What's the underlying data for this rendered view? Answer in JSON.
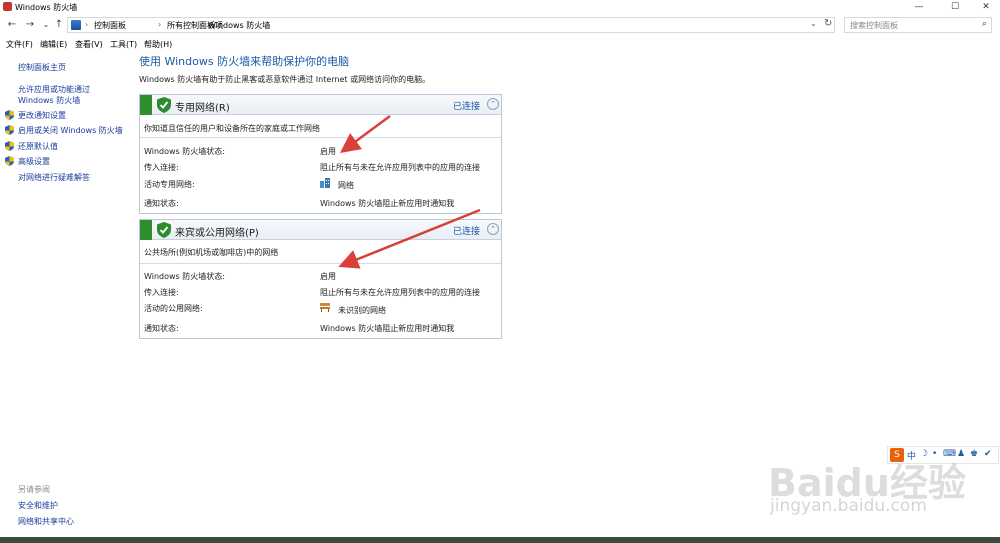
{
  "window": {
    "title": "Windows 防火墙",
    "min": "—",
    "max": "☐",
    "close": "✕"
  },
  "nav": {
    "back": "←",
    "forward": "→",
    "dropdown": "⌄",
    "up": "↑"
  },
  "breadcrumb": {
    "items": [
      "控制面板",
      "所有控制面板项",
      "Windows 防火墙"
    ],
    "sep": "›",
    "dd": "⌄",
    "refresh": "↻"
  },
  "search": {
    "placeholder": "搜索控制面板",
    "icon": "⌕"
  },
  "menu": [
    "文件(F)",
    "编辑(E)",
    "查看(V)",
    "工具(T)",
    "帮助(H)"
  ],
  "sidebar": {
    "home": "控制面板主页",
    "allow_app": "允许应用或功能通过 Windows 防火墙",
    "items": [
      "更改通知设置",
      "启用或关闭 Windows 防火墙",
      "还原默认值",
      "高级设置"
    ],
    "troubleshoot": "对网络进行疑难解答",
    "see_also_title": "另请参阅",
    "see_also": [
      "安全和维护",
      "网络和共享中心"
    ]
  },
  "main": {
    "title": "使用 Windows 防火墙来帮助保护你的电脑",
    "description": "Windows 防火墙有助于防止黑客或恶意软件通过 Internet 或网络访问你的电脑。"
  },
  "panels": [
    {
      "name": "专用网络(R)",
      "status": "已连接",
      "chevron": "⌃",
      "description": "你知道且信任的用户和设备所在的家庭或工作网络",
      "rows": [
        {
          "label": "Windows 防火墙状态:",
          "value": "启用"
        },
        {
          "label": "传入连接:",
          "value": "阻止所有与未在允许应用列表中的应用的连接"
        },
        {
          "label": "活动专用网络:",
          "value": "网络"
        },
        {
          "label": "通知状态:",
          "value": "Windows 防火墙阻止新应用时通知我"
        }
      ]
    },
    {
      "name": "来宾或公用网络(P)",
      "status": "已连接",
      "chevron": "⌃",
      "description": "公共场所(例如机场或咖啡店)中的网络",
      "rows": [
        {
          "label": "Windows 防火墙状态:",
          "value": "启用"
        },
        {
          "label": "传入连接:",
          "value": "阻止所有与未在允许应用列表中的应用的连接"
        },
        {
          "label": "活动的公用网络:",
          "value": "未识别的网络"
        },
        {
          "label": "通知状态:",
          "value": "Windows 防火墙阻止新应用时通知我"
        }
      ]
    }
  ],
  "tray": {
    "logo": "S",
    "lang": "中",
    "moon": "☽",
    "dot": "•",
    "punct": "⌨",
    "person": "♟",
    "shirt": "♚",
    "wrench": "✔"
  },
  "watermark": {
    "brand": "Baidu经验",
    "url": "jingyan.baidu.com"
  },
  "colors": {
    "accent": "#1b5aa6",
    "link": "#1a3c9c",
    "firewall_green": "#2f8f2f",
    "arrow": "#d9403a"
  }
}
